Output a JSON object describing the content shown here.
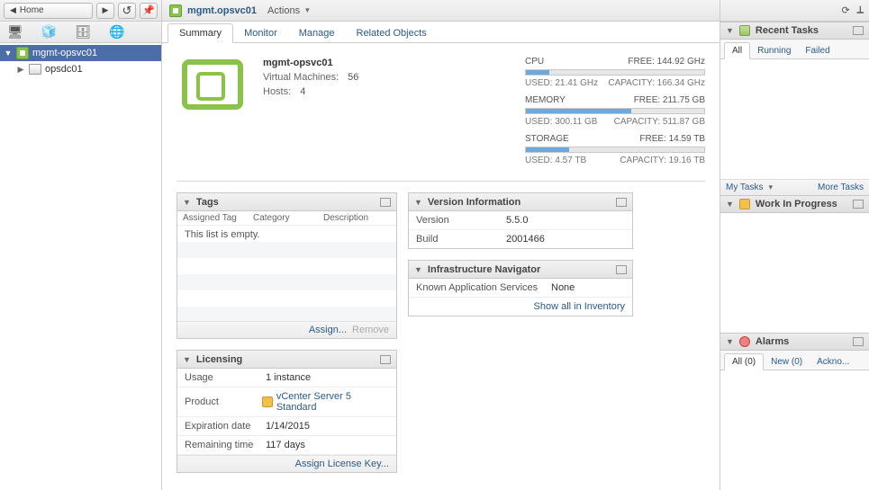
{
  "nav": {
    "home": "Home"
  },
  "tree": {
    "root": "mgmt-opsvc01",
    "child": "opsdc01"
  },
  "header": {
    "title": "mgmt.opsvc01",
    "actions": "Actions"
  },
  "tabs": [
    "Summary",
    "Monitor",
    "Manage",
    "Related Objects"
  ],
  "summary": {
    "name": "mgmt-opsvc01",
    "rows": [
      {
        "label": "Virtual Machines:",
        "value": "56"
      },
      {
        "label": "Hosts:",
        "value": "4"
      }
    ]
  },
  "metrics": [
    {
      "name": "CPU",
      "free": "FREE: 144.92 GHz",
      "fillPct": 13,
      "used": "USED: 21.41 GHz",
      "cap": "CAPACITY: 166.34 GHz"
    },
    {
      "name": "MEMORY",
      "free": "FREE: 211.75 GB",
      "fillPct": 59,
      "used": "USED: 300.11 GB",
      "cap": "CAPACITY: 511.87 GB"
    },
    {
      "name": "STORAGE",
      "free": "FREE: 14.59 TB",
      "fillPct": 24,
      "used": "USED: 4.57 TB",
      "cap": "CAPACITY: 19.16 TB"
    }
  ],
  "tags": {
    "title": "Tags",
    "cols": [
      "Assigned Tag",
      "Category",
      "Description"
    ],
    "empty": "This list is empty.",
    "assign": "Assign...",
    "remove": "Remove"
  },
  "version": {
    "title": "Version Information",
    "rows": [
      {
        "k": "Version",
        "v": "5.5.0"
      },
      {
        "k": "Build",
        "v": "2001466"
      }
    ]
  },
  "infra": {
    "title": "Infrastructure Navigator",
    "rowKey": "Known Application Services",
    "rowVal": "None",
    "link": "Show all in Inventory"
  },
  "licensing": {
    "title": "Licensing",
    "rows": [
      {
        "k": "Usage",
        "v": "1 instance"
      },
      {
        "k": "Product",
        "v": "vCenter Server 5 Standard",
        "link": true
      },
      {
        "k": "Expiration date",
        "v": "1/14/2015"
      },
      {
        "k": "Remaining time",
        "v": "117 days"
      }
    ],
    "assign": "Assign License Key..."
  },
  "right": {
    "recent": {
      "title": "Recent Tasks",
      "tabs": [
        "All",
        "Running",
        "Failed"
      ],
      "my": "My Tasks",
      "more": "More Tasks"
    },
    "wip": {
      "title": "Work In Progress"
    },
    "alarms": {
      "title": "Alarms",
      "tabs": [
        "All (0)",
        "New (0)",
        "Ackno..."
      ]
    }
  }
}
